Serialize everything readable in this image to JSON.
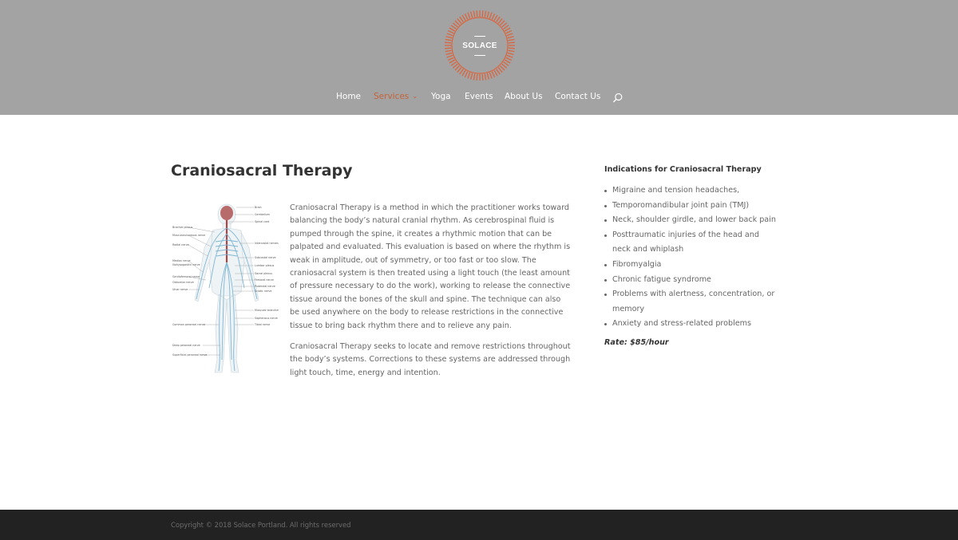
{
  "brand": {
    "logo_text": "SOLACE",
    "accent_color": "#d9663f"
  },
  "nav": {
    "items": [
      {
        "label": "Home",
        "active": false
      },
      {
        "label": "Services",
        "active": true,
        "has_dropdown": true
      },
      {
        "label": "Yoga",
        "active": false
      },
      {
        "label": "Events",
        "active": false
      },
      {
        "label": "About Us",
        "active": false
      },
      {
        "label": "Contact Us",
        "active": false
      }
    ],
    "search_icon": "search-icon"
  },
  "main": {
    "title": "Craniosacral Therapy",
    "figure": {
      "labels_left": [
        "Brachial plexus",
        "Musculocutaneous nerve",
        "Radial nerve",
        "Median nerve",
        "Iliohypogastric nerve",
        "Genitofemoral nerve",
        "Obturator nerve",
        "Ulnar nerve",
        "Common peroneal nerve",
        "Deep peroneal nerve",
        "Superficial peroneal nerve"
      ],
      "labels_right": [
        "Brain",
        "Cerebellum",
        "Spinal cord",
        "Intercostal nerves",
        "Subcostal nerve",
        "Lumbar plexus",
        "Sacral plexus",
        "Femoral nerve",
        "Pudendal nerve",
        "Sciatic nerve",
        "Muscular branches of femoral nerve",
        "Saphenous nerve",
        "Tibial nerve"
      ]
    },
    "paragraphs": [
      "Craniosacral Therapy is a method in which the practitioner works toward balancing the body’s natural cranial rhythm. As cerebrospinal fluid is pumped through the spine, it creates a rhythmic motion that can be palpated and evaluated. This evaluation is based on where the rhythm is weak in amplitude, out of symmetry, or too fast or too slow. The craniosacral system is then treated using a light touch (the least amount of pressure necessary to do the work), working to release the connective tissue around the bones of the skull and spine. The technique can also be used anywhere on the body to release restrictions in the connective tissue to bring back rhythm there and to relieve any pain.",
      "Craniosacral Therapy seeks to locate and remove restrictions throughout the body’s systems. Corrections to these systems are addressed through light touch, time, energy and intention."
    ]
  },
  "sidebar": {
    "title": "Indications for Craniosacral Therapy",
    "items": [
      "Migraine and tension headaches,",
      "Temporomandibular joint pain (TMJ)",
      "Neck, shoulder girdle, and lower back pain",
      "Posttraumatic injuries of the head and neck and whiplash",
      "Fibromyalgia",
      "Chronic fatigue syndrome",
      "Problems with alertness, concentration, or memory",
      "Anxiety and stress-related problems"
    ],
    "rate": "Rate: $85/hour"
  },
  "footer": {
    "copyright": "Copyright © 2018 Solace Portland. All rights reserved"
  }
}
